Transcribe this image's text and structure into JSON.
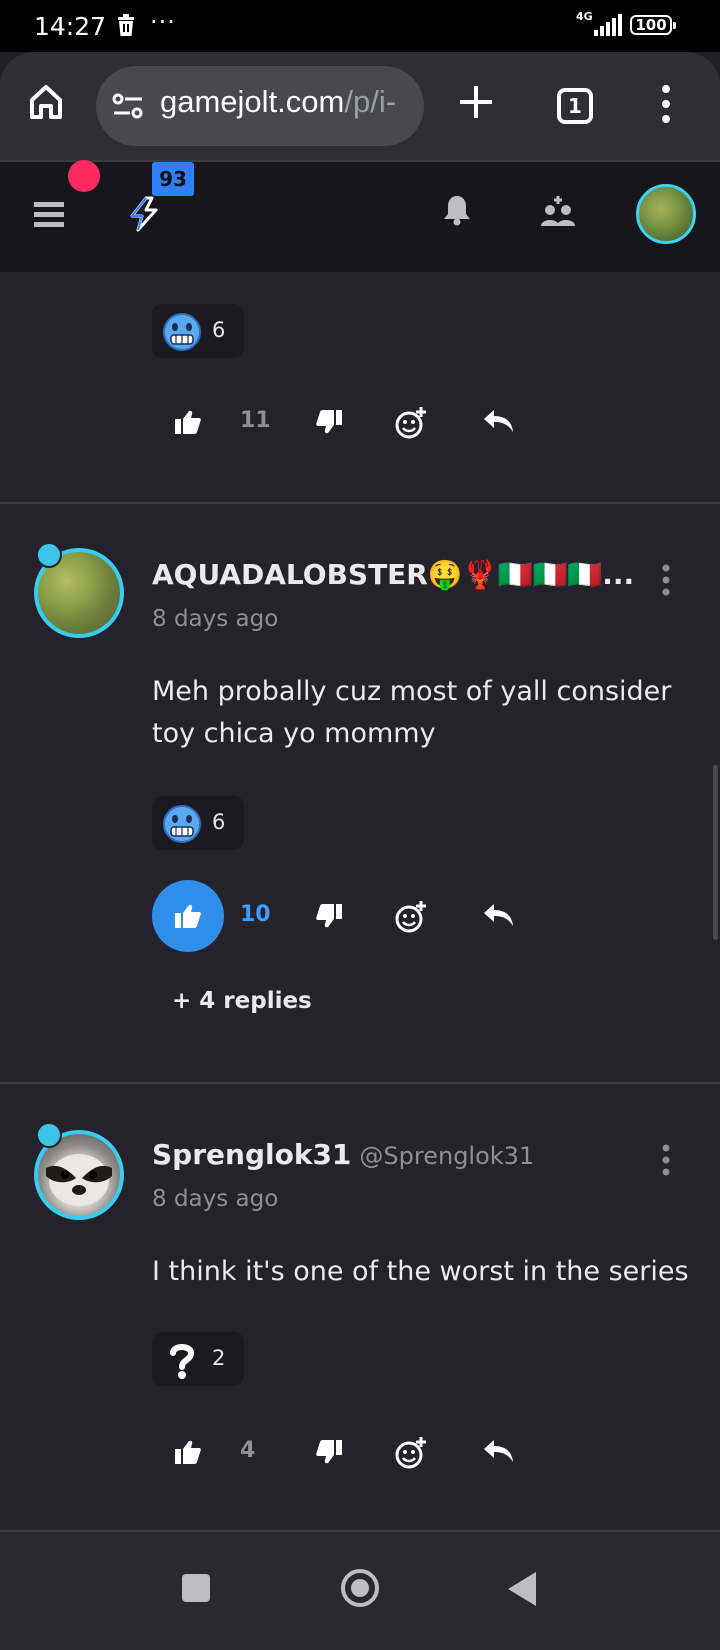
{
  "status_bar": {
    "time": "14:27",
    "network": "4G",
    "battery": "100"
  },
  "browser": {
    "url_main": "gamejolt.com",
    "url_path": "/p/i-",
    "tab_count": "1"
  },
  "header": {
    "notification_badge": "93"
  },
  "comments": [
    {
      "reaction": {
        "emoji": "cold-face-icon",
        "count": "6"
      },
      "like_count": "11",
      "liked": false
    },
    {
      "username": "AQUADALOBSTER🤑🦞🇮🇹🇮🇹🇮🇹...",
      "timestamp": "8 days ago",
      "text": "Meh probally cuz most of yall consider toy chica yo mommy",
      "reaction": {
        "emoji": "cold-face-icon",
        "count": "6"
      },
      "like_count": "10",
      "liked": true,
      "replies_label": "+ 4 replies"
    },
    {
      "username": "Sprenglok31",
      "handle": "@Sprenglok31",
      "timestamp": "8 days ago",
      "text": "I think it's one of the worst in the series",
      "reaction": {
        "emoji": "question-mark-icon",
        "count": "2"
      },
      "like_count": "4",
      "liked": false
    }
  ],
  "colors": {
    "accent": "#2f8fea",
    "background": "#24232b",
    "header": "#17161b",
    "avatar_ring": "#36cdf0",
    "notification": "#ff2a5f"
  }
}
